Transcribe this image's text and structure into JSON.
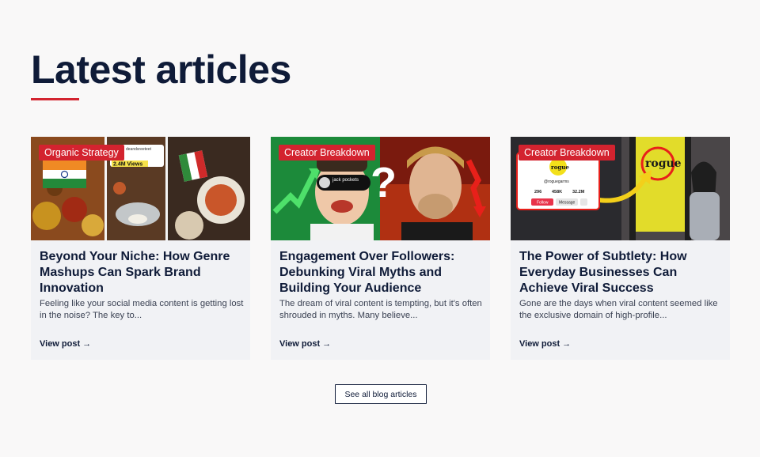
{
  "section": {
    "heading": "Latest articles",
    "see_all_label": "See all blog articles"
  },
  "colors": {
    "accent": "#d3232f",
    "heading": "#0f1b38",
    "card_bg": "#f1f2f5",
    "page_bg": "#f9f8f8"
  },
  "articles": [
    {
      "tag": "Organic Strategy",
      "title": "Beyond Your Niche: How Genre Mashups Can Spark Brand Innovation",
      "excerpt": "Feeling like your social media content is getting lost in the noise? The key to...",
      "link_label": "View post",
      "thumb": {
        "views_badge": "2.4M Views",
        "account_name": "deandsreeteet"
      }
    },
    {
      "tag": "Creator Breakdown",
      "title": "Engagement Over Followers: Debunking Viral Myths and Building Your Audience",
      "excerpt": "The dream of viral content is tempting, but it's often shrouded in myths. Many believe...",
      "link_label": "View post",
      "thumb": {
        "profile_name": "jack pockets",
        "question_mark": "?"
      }
    },
    {
      "tag": "Creator Breakdown",
      "title": "The Power of Subtlety: How Everyday Businesses Can Achieve Viral Success",
      "excerpt": "Gone are the days when viral content seemed like the exclusive domain of high-profile...",
      "link_label": "View post",
      "thumb": {
        "brand_logo": "rogue",
        "handle": "@roguegarms",
        "stats": [
          "296",
          "458K",
          "32.2M"
        ],
        "follow_label": "Follow",
        "message_label": "Message"
      }
    }
  ],
  "icons": {
    "link_arrow": "arrow-right-icon"
  }
}
